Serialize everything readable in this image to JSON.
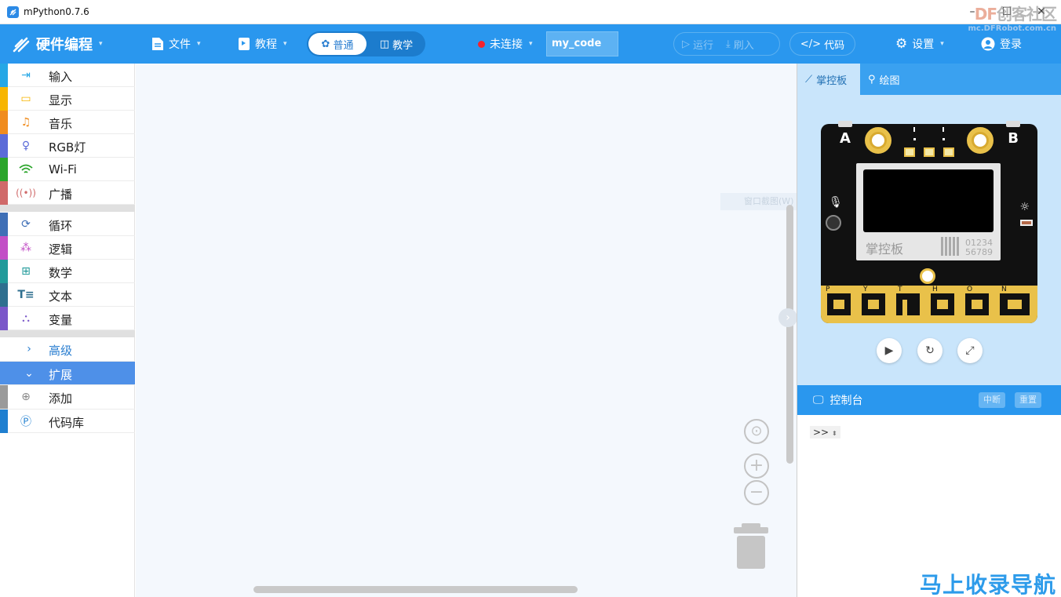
{
  "window": {
    "title": "mPython0.7.6",
    "minimize": "–",
    "maximize": "☐",
    "close": "✕"
  },
  "watermark": {
    "brand_left": "DF",
    "brand_right": "创客社区",
    "url": "mc.DFRobot.com.cn",
    "bottom": "马上收录导航"
  },
  "toolbar": {
    "brand": "硬件编程",
    "file": "文件",
    "tutorial": "教程",
    "mode_normal": "普通",
    "mode_teaching": "教学",
    "connection": "未连接",
    "filename": "my_code",
    "run": "运行",
    "flash": "刷入",
    "code": "代码",
    "settings": "设置",
    "login": "登录"
  },
  "sidebar": {
    "group1": [
      {
        "label": "输入",
        "color": "#25a7e6",
        "icon": "input-icon"
      },
      {
        "label": "显示",
        "color": "#f7b500",
        "icon": "display-icon"
      },
      {
        "label": "音乐",
        "color": "#f08c1e",
        "icon": "music-icon"
      },
      {
        "label": "RGB灯",
        "color": "#5b6bd8",
        "icon": "bulb-icon"
      },
      {
        "label": "Wi-Fi",
        "color": "#2ba52b",
        "icon": "wifi-icon"
      },
      {
        "label": "广播",
        "color": "#d06a6a",
        "icon": "broadcast-icon"
      }
    ],
    "group2": [
      {
        "label": "循环",
        "color": "#3f6fb6",
        "icon": "loop-icon"
      },
      {
        "label": "逻辑",
        "color": "#c24fc6",
        "icon": "logic-icon"
      },
      {
        "label": "数学",
        "color": "#219a9a",
        "icon": "math-icon"
      },
      {
        "label": "文本",
        "color": "#2f6f8f",
        "icon": "text-icon"
      },
      {
        "label": "变量",
        "color": "#7a57c9",
        "icon": "variable-icon"
      }
    ],
    "advanced": "高级",
    "extension": "扩展",
    "add": "添加",
    "codelib": "代码库"
  },
  "workspace": {
    "ghost_text": "窗口截图(W)"
  },
  "right_panel": {
    "tab_board": "掌控板",
    "tab_draw": "绘图",
    "board_label_a": "A",
    "board_label_b": "B",
    "board_logo": "掌控板",
    "board_digits_1": "01234",
    "board_digits_2": "56789",
    "board_pins": [
      "P",
      "Y",
      "T",
      "H",
      "O",
      "N"
    ],
    "console_title": "控制台",
    "console_interrupt": "中断",
    "console_reset": "重置",
    "console_prompt": ">>"
  },
  "colors": {
    "accent": "#2a97ee",
    "active_category": "#4e90e8",
    "workspace_bg": "#f4f8fd",
    "sim_bg": "#c9e5fb",
    "gold": "#e9c14a"
  }
}
